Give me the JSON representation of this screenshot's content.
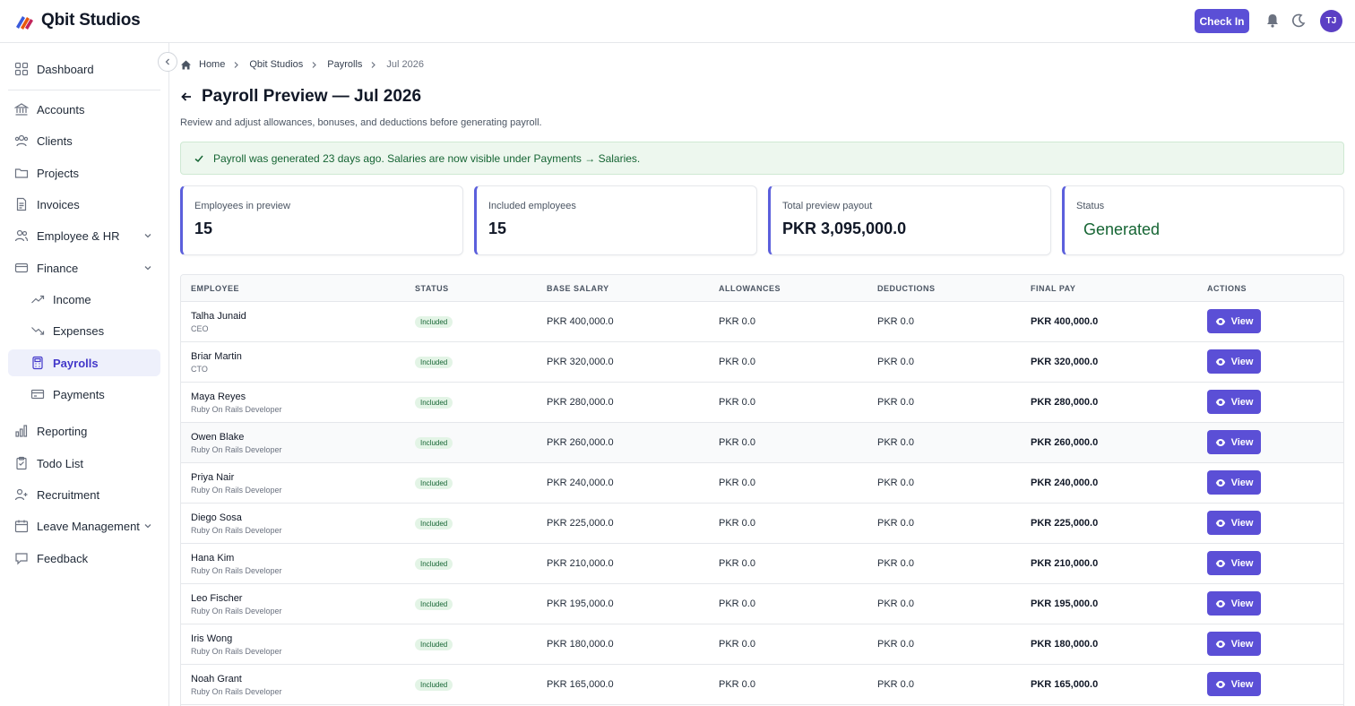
{
  "app": {
    "brand": "Qbit Studios"
  },
  "topbar": {
    "checkin_label": "Check In",
    "avatar_initials": "TJ"
  },
  "sidebar": {
    "items": [
      {
        "label": "Dashboard",
        "icon": "grid-icon"
      },
      {
        "label": "Accounts",
        "icon": "bank-icon"
      },
      {
        "label": "Clients",
        "icon": "users-icon"
      },
      {
        "label": "Projects",
        "icon": "folder-icon"
      },
      {
        "label": "Invoices",
        "icon": "document-icon"
      },
      {
        "label": "Employee & HR",
        "icon": "people-icon",
        "expandable": true
      },
      {
        "label": "Finance",
        "icon": "card-icon",
        "expanded": true
      },
      {
        "label": "Income",
        "icon": "trend-up-icon",
        "sub": true
      },
      {
        "label": "Expenses",
        "icon": "trend-down-icon",
        "sub": true
      },
      {
        "label": "Payrolls",
        "icon": "calculator-icon",
        "sub": true,
        "active": true
      },
      {
        "label": "Payments",
        "icon": "wallet-icon",
        "sub": true
      },
      {
        "label": "Reporting",
        "icon": "bar-chart-icon"
      },
      {
        "label": "Todo List",
        "icon": "clipboard-icon"
      },
      {
        "label": "Recruitment",
        "icon": "user-add-icon"
      },
      {
        "label": "Leave Management",
        "icon": "calendar-icon",
        "expandable": true
      },
      {
        "label": "Feedback",
        "icon": "chat-icon"
      }
    ]
  },
  "breadcrumb": {
    "home": "Home",
    "org": "Qbit Studios",
    "section": "Payrolls",
    "current": "Jul 2026"
  },
  "page": {
    "title": "Payroll Preview — Jul 2026",
    "subtitle": "Review and adjust allowances, bonuses, and deductions before generating payroll.",
    "banner": "Payroll was generated 23 days ago. Salaries are now visible under Payments → Salaries."
  },
  "stats": [
    {
      "label": "Employees in preview",
      "value": "15"
    },
    {
      "label": "Included employees",
      "value": "15"
    },
    {
      "label": "Total preview payout",
      "value": "PKR 3,095,000.0"
    },
    {
      "label": "Status",
      "value": "Generated"
    }
  ],
  "table": {
    "columns": [
      "EMPLOYEE",
      "STATUS",
      "BASE SALARY",
      "ALLOWANCES",
      "DEDUCTIONS",
      "FINAL PAY",
      "ACTIONS"
    ],
    "action_label": "View",
    "rows": [
      {
        "name": "Talha Junaid",
        "role": "CEO",
        "status": "Included",
        "base": "PKR 400,000.0",
        "allowances": "PKR 0.0",
        "deductions": "PKR 0.0",
        "final": "PKR 400,000.0"
      },
      {
        "name": "Briar Martin",
        "role": "CTO",
        "status": "Included",
        "base": "PKR 320,000.0",
        "allowances": "PKR 0.0",
        "deductions": "PKR 0.0",
        "final": "PKR 320,000.0"
      },
      {
        "name": "Maya Reyes",
        "role": "Ruby On Rails Developer",
        "status": "Included",
        "base": "PKR 280,000.0",
        "allowances": "PKR 0.0",
        "deductions": "PKR 0.0",
        "final": "PKR 280,000.0"
      },
      {
        "name": "Owen Blake",
        "role": "Ruby On Rails Developer",
        "status": "Included",
        "base": "PKR 260,000.0",
        "allowances": "PKR 0.0",
        "deductions": "PKR 0.0",
        "final": "PKR 260,000.0"
      },
      {
        "name": "Priya Nair",
        "role": "Ruby On Rails Developer",
        "status": "Included",
        "base": "PKR 240,000.0",
        "allowances": "PKR 0.0",
        "deductions": "PKR 0.0",
        "final": "PKR 240,000.0"
      },
      {
        "name": "Diego Sosa",
        "role": "Ruby On Rails Developer",
        "status": "Included",
        "base": "PKR 225,000.0",
        "allowances": "PKR 0.0",
        "deductions": "PKR 0.0",
        "final": "PKR 225,000.0"
      },
      {
        "name": "Hana Kim",
        "role": "Ruby On Rails Developer",
        "status": "Included",
        "base": "PKR 210,000.0",
        "allowances": "PKR 0.0",
        "deductions": "PKR 0.0",
        "final": "PKR 210,000.0"
      },
      {
        "name": "Leo Fischer",
        "role": "Ruby On Rails Developer",
        "status": "Included",
        "base": "PKR 195,000.0",
        "allowances": "PKR 0.0",
        "deductions": "PKR 0.0",
        "final": "PKR 195,000.0"
      },
      {
        "name": "Iris Wong",
        "role": "Ruby On Rails Developer",
        "status": "Included",
        "base": "PKR 180,000.0",
        "allowances": "PKR 0.0",
        "deductions": "PKR 0.0",
        "final": "PKR 180,000.0"
      },
      {
        "name": "Noah Grant",
        "role": "Ruby On Rails Developer",
        "status": "Included",
        "base": "PKR 165,000.0",
        "allowances": "PKR 0.0",
        "deductions": "PKR 0.0",
        "final": "PKR 165,000.0"
      }
    ]
  },
  "colors": {
    "accent": "#5b4fd6",
    "success": "#166534",
    "success_bg": "#edf7ee"
  }
}
